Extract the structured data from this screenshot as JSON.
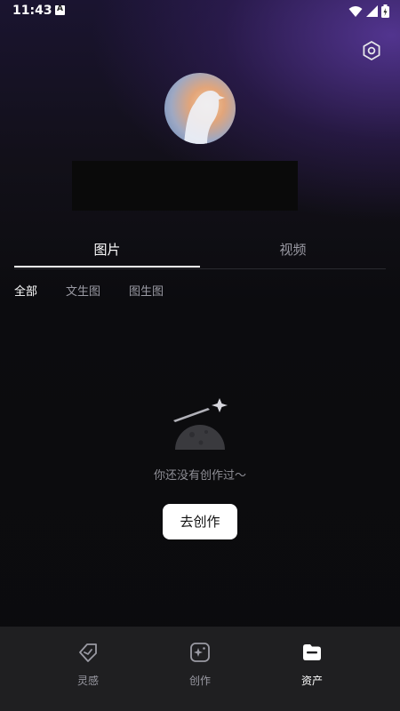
{
  "status_bar": {
    "time": "11:43"
  },
  "tabs": [
    {
      "label": "图片",
      "active": true
    },
    {
      "label": "视频",
      "active": false
    }
  ],
  "filters": [
    {
      "label": "全部",
      "active": true
    },
    {
      "label": "文生图",
      "active": false
    },
    {
      "label": "图生图",
      "active": false
    }
  ],
  "empty_state": {
    "message": "你还没有创作过～",
    "button_label": "去创作"
  },
  "bottom_nav": [
    {
      "label": "灵感",
      "icon": "tag-icon",
      "active": false
    },
    {
      "label": "创作",
      "icon": "sparkle-square-icon",
      "active": false
    },
    {
      "label": "资产",
      "icon": "folder-icon",
      "active": true
    }
  ],
  "colors": {
    "accent_gradient": "#5c3aa0",
    "nav_bg": "#1f1f21"
  }
}
